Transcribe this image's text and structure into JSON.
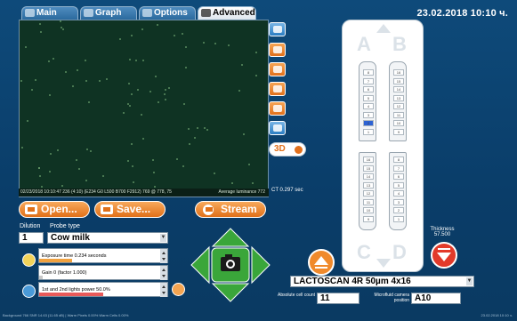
{
  "tabs": [
    {
      "label": "Main",
      "icon": "monitor-icon",
      "active": false
    },
    {
      "label": "Graph",
      "icon": "graph-icon",
      "active": false
    },
    {
      "label": "Options",
      "icon": "options-icon",
      "active": false
    },
    {
      "label": "Advanced",
      "icon": "advanced-icon",
      "active": true
    }
  ],
  "datetime": "23.02.2018 10:10 ч.",
  "viewer": {
    "status_left": "02/23/2018 10:10:47 236 (4:10) (E234 G0 L500 B700 F2912) 769 @ 778, 75",
    "status_right": "Average luminance 772",
    "ct_time": "CT 0.297 sec"
  },
  "buttons": {
    "open": "Open...",
    "save": "Save...",
    "stream": "Stream"
  },
  "toggle_label": "3D",
  "dilution": {
    "label": "Dilution",
    "value": "1"
  },
  "probe_type": {
    "label": "Probe type",
    "value": "Cow milk"
  },
  "settings": {
    "exposure": {
      "label": "Exposure time 0.234 seconds",
      "level": 0.2
    },
    "gain": {
      "label": "Gain 0 (factor 1.000)",
      "level": 0.0
    },
    "lights": {
      "label": "1st and 2nd lights power 50.0%",
      "level": 0.5
    }
  },
  "slide": {
    "letters": [
      "A",
      "B",
      "C",
      "D"
    ],
    "strip_top_left": [
      "8",
      "7",
      "6",
      "5",
      "4",
      "3",
      "2",
      "1"
    ],
    "strip_top_right": [
      "16",
      "15",
      "14",
      "13",
      "12",
      "11",
      "10",
      "9"
    ],
    "strip_top_left_cols": [
      "16",
      "15",
      "14",
      "13",
      "12",
      "11",
      "10",
      "9"
    ],
    "strip_bottom_left": [
      "16",
      "15",
      "14",
      "13",
      "12",
      "11",
      "10",
      "9"
    ],
    "strip_bottom_right": [
      "8",
      "7",
      "6",
      "5",
      "4",
      "3",
      "2",
      "1"
    ],
    "selected_cell": "2"
  },
  "thickness": {
    "label": "Thickness",
    "value": "57.500"
  },
  "slide_type": "LACTOSCAN 4R 50µm 4x16",
  "absolute_cell_count": {
    "label": "Absolute cell count",
    "value": "11"
  },
  "microfluid_position": {
    "label": "Microfluid camera position",
    "value": "A10"
  },
  "footer": "Background 766  SNR 14.63 (11.65 dB)  |  Warm Pixels 0.00%  Warm Cells 0.00%",
  "footer_right": "23.02.2018 10:10 ч.",
  "colors": {
    "accent_orange": "#e07019",
    "accent_green": "#3aa63a",
    "background_blue": "#0e4a7a",
    "selection_blue": "#2c62d4",
    "danger_red": "#e23a2a"
  }
}
